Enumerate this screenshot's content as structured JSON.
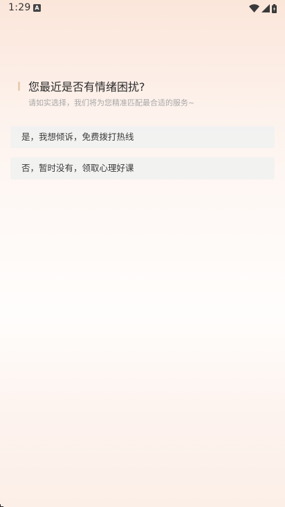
{
  "status_bar": {
    "time": "1:29",
    "notification_icon": "A",
    "icons": [
      "wifi-icon",
      "cellular-icon",
      "battery-icon"
    ]
  },
  "question": {
    "title": "您最近是否有情绪困扰?",
    "subtitle": "请如实选择，我们将为您精准匹配最合适的服务~"
  },
  "options": [
    {
      "label": "是，我想倾诉，免费拨打热线"
    },
    {
      "label": "否，暂时没有，领取心理好课"
    }
  ],
  "colors": {
    "accent_bar": "#e8cdb4",
    "option_bg": "#f1f1f1",
    "title_text": "#2b2b2b",
    "subtitle_text": "#a8a8a8"
  }
}
